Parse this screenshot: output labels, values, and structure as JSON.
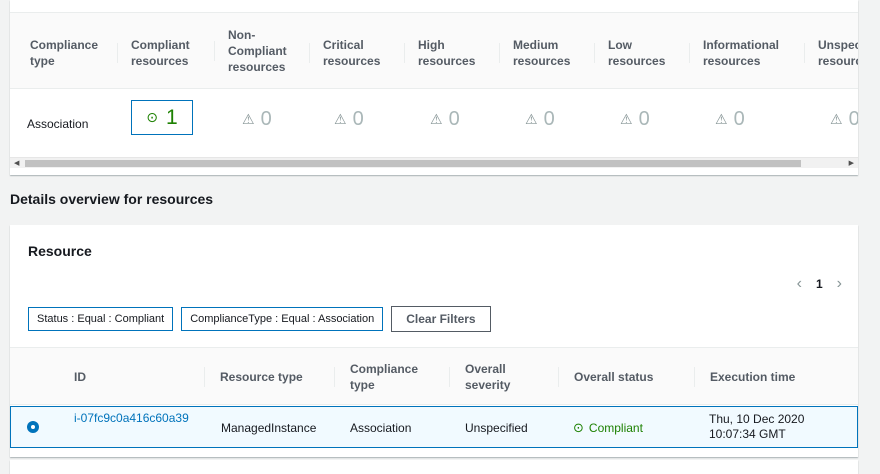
{
  "summary": {
    "headers": [
      "Compliance type",
      "Compliant resources",
      "Non-Compliant resources",
      "Critical resources",
      "High resources",
      "Medium resources",
      "Low resources",
      "Informational resources",
      "Unspecified resources"
    ],
    "row": {
      "type": "Association",
      "compliant": "1",
      "non_compliant": "0",
      "critical": "0",
      "high": "0",
      "medium": "0",
      "low": "0",
      "informational": "0",
      "unspecified": "0"
    }
  },
  "details_title": "Details overview for resources",
  "resource_panel": {
    "title": "Resource",
    "page": "1",
    "filters": [
      "Status : Equal : Compliant",
      "ComplianceType : Equal : Association"
    ],
    "clear_label": "Clear Filters",
    "columns": [
      "ID",
      "Resource type",
      "Compliance type",
      "Overall severity",
      "Overall status",
      "Execution time"
    ],
    "rows": [
      {
        "id": "i-07fc9c0a416c60a39",
        "resource_type": "ManagedInstance",
        "compliance_type": "Association",
        "severity": "Unspecified",
        "status": "Compliant",
        "execution_time": "Thu, 10 Dec 2020 10:07:34 GMT"
      }
    ]
  },
  "icons": {
    "compliant": "check-circle-icon",
    "warning": "warning-triangle-icon",
    "prev": "chevron-left-icon",
    "next": "chevron-right-icon"
  },
  "colors": {
    "accent": "#0073bb",
    "success": "#1d8102",
    "muted": "#aab7b8"
  }
}
